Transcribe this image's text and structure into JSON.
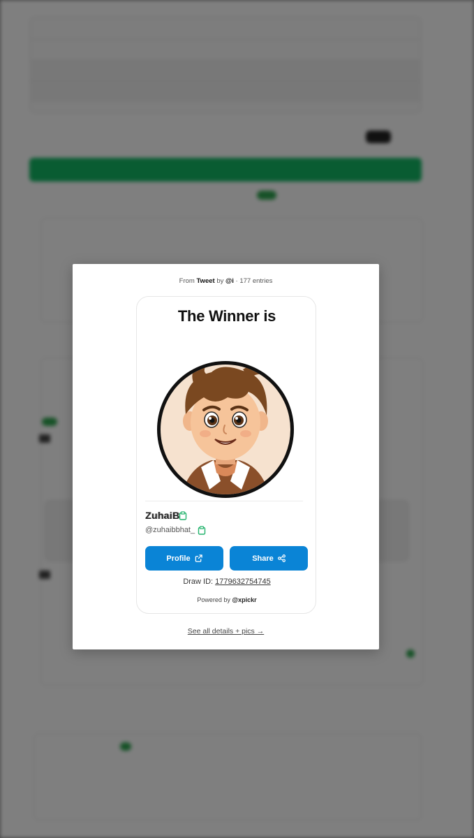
{
  "modal": {
    "meta": {
      "prefix": "From",
      "source": "Tweet",
      "by": "by",
      "author": "@i",
      "entries": "· 177 entries"
    },
    "card": {
      "title": "The Winner is",
      "winner_name": "ZuhaiB",
      "winner_handle": "@zuhaibbhat_",
      "profile_button": "Profile",
      "share_button": "Share",
      "draw_id_label": "Draw ID:",
      "draw_id": "1779632754745",
      "powered_by_label": "Powered by",
      "powered_by_brand": "@xpickr"
    },
    "see_all_link": "See all details + pics →"
  },
  "colors": {
    "accent_blue": "#0a84d6",
    "copy_icon_green": "#21b26b",
    "bg_green": "#12b864"
  },
  "icons": [
    "copy-icon",
    "external-link-icon",
    "share-icon"
  ]
}
